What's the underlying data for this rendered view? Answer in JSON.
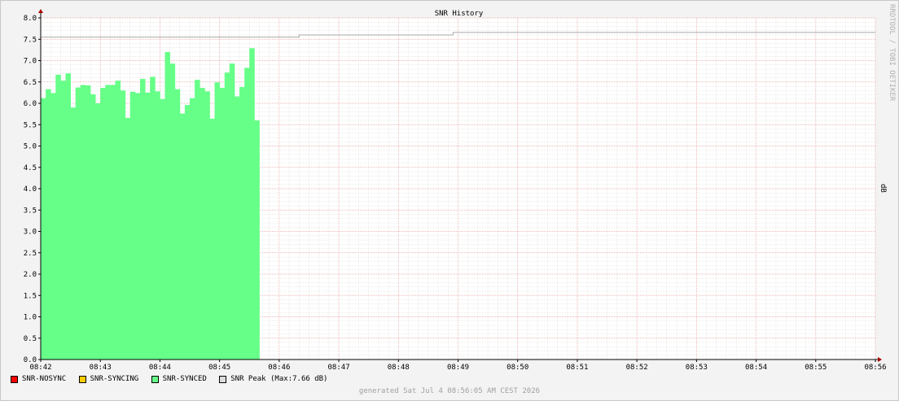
{
  "chart_data": {
    "type": "area",
    "title": "SNR History",
    "ylabel": "dB",
    "ylim": [
      0,
      8
    ],
    "y_ticks": [
      "0.0",
      "0.5",
      "1.0",
      "1.5",
      "2.0",
      "2.5",
      "3.0",
      "3.5",
      "4.0",
      "4.5",
      "5.0",
      "5.5",
      "6.0",
      "6.5",
      "7.0",
      "7.5",
      "8.0"
    ],
    "x_start": "08:42",
    "x_end": "08:56",
    "x_ticks": [
      "08:42",
      "08:43",
      "08:44",
      "08:45",
      "08:46",
      "08:47",
      "08:48",
      "08:49",
      "08:50",
      "08:51",
      "08:52",
      "08:53",
      "08:54",
      "08:55",
      "08:56"
    ],
    "grid": true,
    "colors": {
      "synced": "#66ff88",
      "nosync": "#ff0000",
      "syncing": "#ffcc00",
      "peak": "#aaaaaa",
      "major_grid": "#e8a0a0",
      "minor_grid": "#d8d8d8",
      "axis": "#aa0000"
    },
    "series": [
      {
        "name": "SNR-SYNCED",
        "step_seconds": 5,
        "start": "08:42:00",
        "values": [
          6.12,
          6.33,
          6.24,
          6.67,
          6.53,
          6.7,
          5.9,
          6.37,
          6.43,
          6.42,
          6.21,
          6.0,
          6.36,
          6.43,
          6.43,
          6.53,
          6.3,
          5.66,
          6.27,
          6.24,
          6.57,
          6.25,
          6.62,
          6.28,
          6.1,
          7.2,
          6.93,
          6.33,
          5.76,
          5.96,
          6.12,
          6.55,
          6.36,
          6.28,
          5.64,
          6.49,
          6.36,
          6.72,
          6.93,
          6.16,
          6.38,
          6.83,
          7.29,
          5.6
        ]
      },
      {
        "name": "SNR Peak",
        "steps": [
          {
            "from": "08:42:00",
            "value": 7.55
          },
          {
            "from": "08:46:20",
            "value": 7.6
          },
          {
            "from": "08:48:55",
            "value": 7.66
          }
        ]
      }
    ],
    "legend": [
      {
        "label": "SNR-NOSYNC",
        "color": "#ff0000"
      },
      {
        "label": "SNR-SYNCING",
        "color": "#ffcc00"
      },
      {
        "label": "SNR-SYNCED",
        "color": "#66ff88"
      },
      {
        "label": "SNR Peak  (Max:7.66 dB)",
        "color": "#dddddd"
      }
    ],
    "generated": "generated Sat Jul  4 08:56:05 AM CEST 2026",
    "watermark": "RRDTOOL / TOBI OETIKER"
  }
}
